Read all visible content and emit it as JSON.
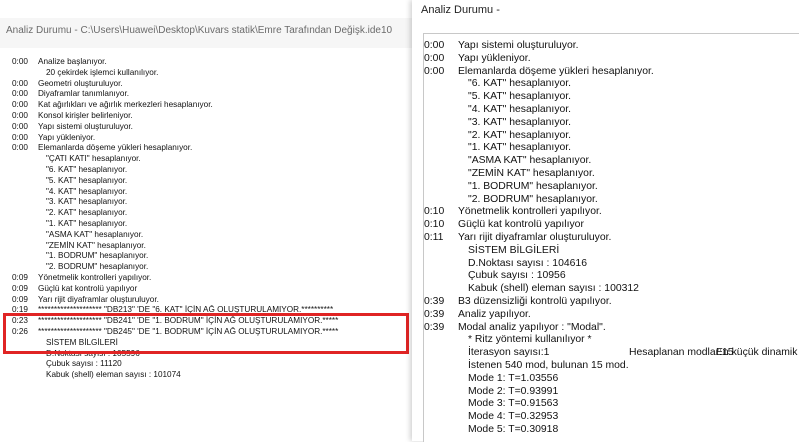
{
  "left_window": {
    "title": "Analiz Durumu - C:\\Users\\Huawei\\Desktop\\Kuvars statik\\Emre Tarafından Değişk.ide10",
    "log": [
      {
        "t": "0:00",
        "m": "Analize başlanıyor."
      },
      {
        "t": "",
        "m": "20 çekirdek işlemci kullanılıyor.",
        "indent": "i1"
      },
      {
        "t": "0:00",
        "m": "Geometri oluşturuluyor."
      },
      {
        "t": "0:00",
        "m": "Diyaframlar tanımlanıyor."
      },
      {
        "t": "0:00",
        "m": "Kat ağırlıkları ve ağırlık merkezleri hesaplanıyor."
      },
      {
        "t": "0:00",
        "m": "Konsol kirişler belirleniyor."
      },
      {
        "t": "0:00",
        "m": "Yapı sistemi oluşturuluyor."
      },
      {
        "t": "0:00",
        "m": "Yapı yükleniyor."
      },
      {
        "t": "0:00",
        "m": "Elemanlarda döşeme yükleri hesaplanıyor."
      },
      {
        "t": "",
        "m": "\"ÇATI KATI\" hesaplanıyor.",
        "indent": "i2"
      },
      {
        "t": "",
        "m": "\"6. KAT\" hesaplanıyor.",
        "indent": "i2"
      },
      {
        "t": "",
        "m": "\"5. KAT\" hesaplanıyor.",
        "indent": "i2"
      },
      {
        "t": "",
        "m": "\"4. KAT\" hesaplanıyor.",
        "indent": "i2"
      },
      {
        "t": "",
        "m": "\"3. KAT\" hesaplanıyor.",
        "indent": "i2"
      },
      {
        "t": "",
        "m": "\"2. KAT\" hesaplanıyor.",
        "indent": "i2"
      },
      {
        "t": "",
        "m": "\"1. KAT\" hesaplanıyor.",
        "indent": "i2"
      },
      {
        "t": "",
        "m": "\"ASMA KAT\" hesaplanıyor.",
        "indent": "i2"
      },
      {
        "t": "",
        "m": "\"ZEMİN KAT\" hesaplanıyor.",
        "indent": "i2"
      },
      {
        "t": "",
        "m": "\"1. BODRUM\" hesaplanıyor.",
        "indent": "i2"
      },
      {
        "t": "",
        "m": "\"2. BODRUM\" hesaplanıyor.",
        "indent": "i2"
      },
      {
        "t": "0:09",
        "m": "Yönetmelik kontrolleri yapılıyor."
      },
      {
        "t": "0:09",
        "m": "Güçlü kat kontrolü yapılıyor"
      },
      {
        "t": "0:09",
        "m": "Yarı rijit diyaframlar oluşturuluyor."
      },
      {
        "t": "0:19",
        "m": "******************** \"DB213\" 'DE \"6. KAT\" İÇİN AĞ OLUŞTURULAMIYOR.**********"
      },
      {
        "t": "0:23",
        "m": "******************** \"DB241\" 'DE \"1. BODRUM\" İÇİN AĞ OLUŞTURULAMIYOR.*****"
      },
      {
        "t": "0:26",
        "m": "******************** \"DB245\" 'DE \"1. BODRUM\" İÇİN AĞ OLUŞTURULAMIYOR.*****"
      },
      {
        "t": "",
        "m": "SİSTEM BİLGİLERİ",
        "indent": "i2"
      },
      {
        "t": "",
        "m": "D.Noktası sayısı : 105596",
        "indent": "i2"
      },
      {
        "t": "",
        "m": "Çubuk sayısı : 11120",
        "indent": "i2"
      },
      {
        "t": "",
        "m": "Kabuk (shell) eleman sayısı : 101074",
        "indent": "i2"
      }
    ]
  },
  "right_window": {
    "title": "Analiz Durumu -",
    "log": [
      {
        "t": "0:00",
        "m": "Yapı sistemi oluşturuluyor."
      },
      {
        "t": "0:00",
        "m": "Yapı yükleniyor."
      },
      {
        "t": "0:00",
        "m": "Elemanlarda döşeme yükleri hesaplanıyor."
      },
      {
        "t": "",
        "m": "\"6. KAT\" hesaplanıyor.",
        "indent": "i2"
      },
      {
        "t": "",
        "m": "\"5. KAT\" hesaplanıyor.",
        "indent": "i2"
      },
      {
        "t": "",
        "m": "\"4. KAT\" hesaplanıyor.",
        "indent": "i2"
      },
      {
        "t": "",
        "m": "\"3. KAT\" hesaplanıyor.",
        "indent": "i2"
      },
      {
        "t": "",
        "m": "\"2. KAT\" hesaplanıyor.",
        "indent": "i2"
      },
      {
        "t": "",
        "m": "\"1. KAT\" hesaplanıyor.",
        "indent": "i2"
      },
      {
        "t": "",
        "m": "\"ASMA KAT\" hesaplanıyor.",
        "indent": "i2"
      },
      {
        "t": "",
        "m": "\"ZEMİN KAT\" hesaplanıyor.",
        "indent": "i2"
      },
      {
        "t": "",
        "m": "\"1. BODRUM\" hesaplanıyor.",
        "indent": "i2"
      },
      {
        "t": "",
        "m": "\"2. BODRUM\" hesaplanıyor.",
        "indent": "i2"
      },
      {
        "t": "0:10",
        "m": "Yönetmelik kontrolleri yapılıyor."
      },
      {
        "t": "0:10",
        "m": "Güçlü kat kontrolü yapılıyor"
      },
      {
        "t": "0:11",
        "m": "Yarı rijit diyaframlar oluşturuluyor."
      },
      {
        "t": "",
        "m": "SİSTEM BİLGİLERİ",
        "indent": "i2"
      },
      {
        "t": "",
        "m": "D.Noktası sayısı : 104616",
        "indent": "i2"
      },
      {
        "t": "",
        "m": "Çubuk sayısı : 10956",
        "indent": "i2"
      },
      {
        "t": "",
        "m": "Kabuk (shell) eleman sayısı : 100312",
        "indent": "i2"
      },
      {
        "t": "0:39",
        "m": "B3 düzensizliği kontrolü yapılıyor."
      },
      {
        "t": "0:39",
        "m": "Analiz yapılıyor."
      },
      {
        "t": "0:39",
        "m": "Modal analiz yapılıyor : \"Modal\"."
      },
      {
        "t": "",
        "m": "* Ritz yöntemi kullanılıyor *",
        "indent": "i1"
      },
      {
        "t": "",
        "m": "İterasyon sayısı:1",
        "indent": "i2",
        "extra": "Hesaplanan modlar:15",
        "extra2": "En küçük dinamik"
      },
      {
        "t": "",
        "m": "İstenen 540 mod, bulunan 15 mod.",
        "indent": "i2"
      },
      {
        "t": "",
        "m": "Mode 1:      T=1.03556",
        "indent": "i2"
      },
      {
        "t": "",
        "m": "Mode 2:      T=0.93991",
        "indent": "i2"
      },
      {
        "t": "",
        "m": "Mode 3:      T=0.91563",
        "indent": "i2"
      },
      {
        "t": "",
        "m": "Mode 4:      T=0.32953",
        "indent": "i2"
      },
      {
        "t": "",
        "m": "Mode 5:      T=0.30918",
        "indent": "i2"
      }
    ]
  },
  "colors": {
    "highlight": "#e02424"
  }
}
